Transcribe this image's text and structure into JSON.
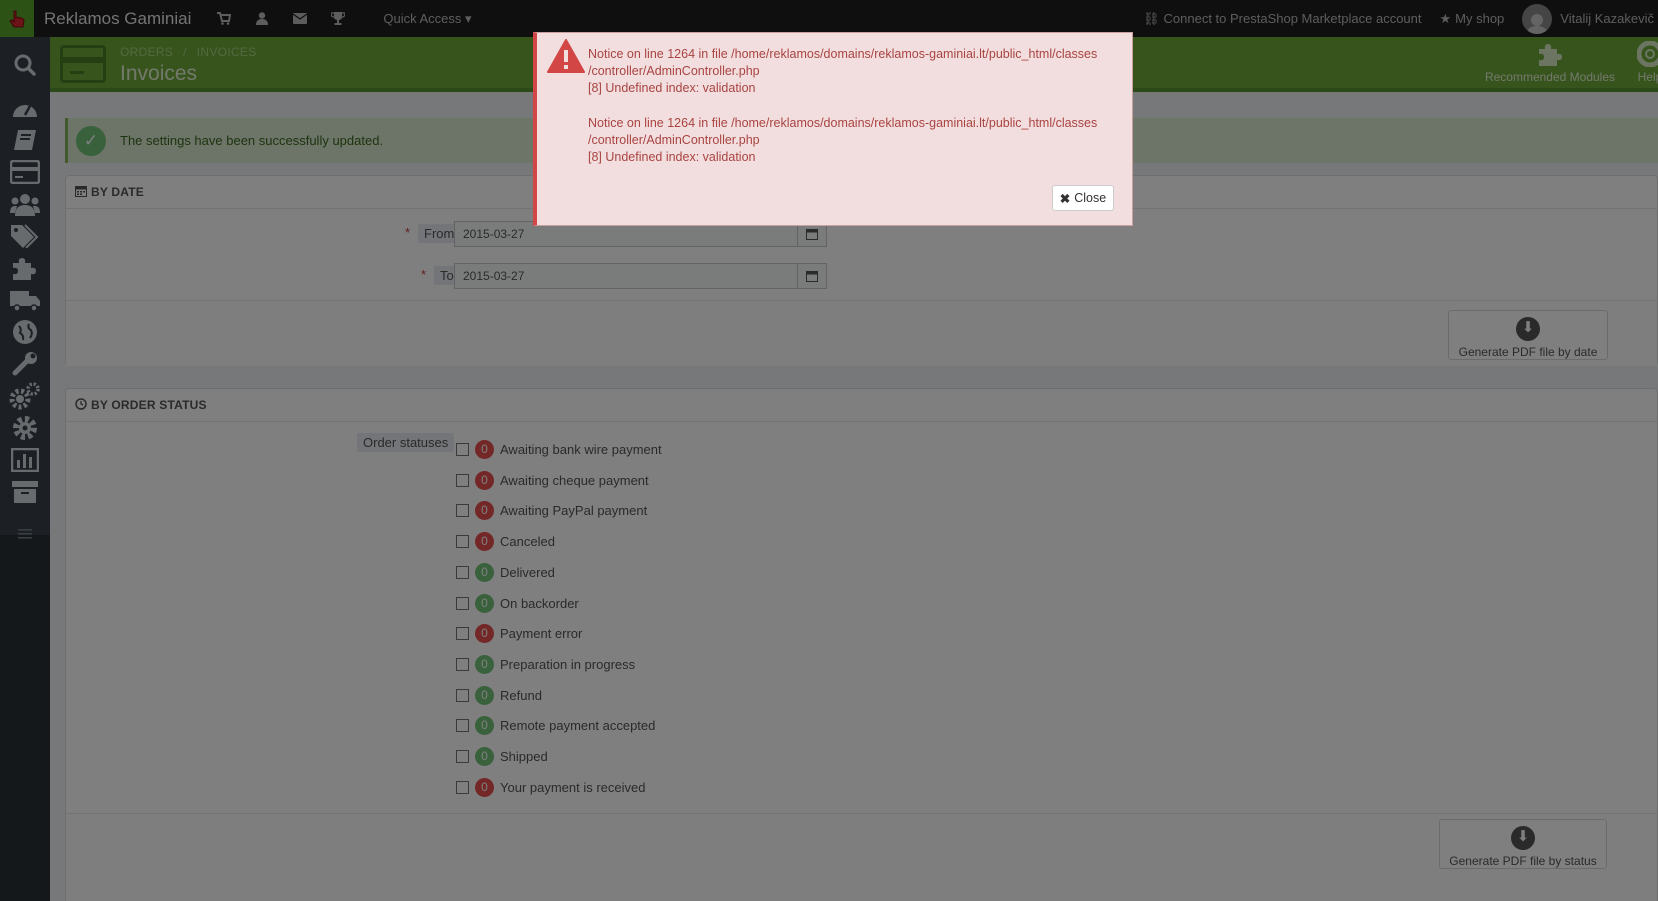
{
  "topbar": {
    "shop_name": "Reklamos Gaminiai",
    "quick_access": "Quick Access",
    "connect_label": "Connect to PrestaShop Marketplace account",
    "my_shop": "My shop",
    "user_name": "Vitalij Kazakevič"
  },
  "header": {
    "breadcrumb": [
      "ORDERS",
      "/",
      "INVOICES"
    ],
    "title": "Invoices",
    "recommended_modules": "Recommended Modules",
    "help": "Help"
  },
  "alert": {
    "success": "The settings have been successfully updated."
  },
  "by_date": {
    "heading": "BY DATE",
    "from_label": "From",
    "from_value": "2015-03-27",
    "to_label": "To",
    "to_value": "2015-03-27",
    "generate_label": "Generate PDF file by date"
  },
  "by_status": {
    "heading": "BY ORDER STATUS",
    "label": "Order statuses",
    "generate_label": "Generate PDF file by status",
    "statuses": [
      {
        "count": "0",
        "color": "red",
        "label": "Awaiting bank wire payment"
      },
      {
        "count": "0",
        "color": "red",
        "label": "Awaiting cheque payment"
      },
      {
        "count": "0",
        "color": "red",
        "label": "Awaiting PayPal payment"
      },
      {
        "count": "0",
        "color": "red",
        "label": "Canceled"
      },
      {
        "count": "0",
        "color": "green",
        "label": "Delivered"
      },
      {
        "count": "0",
        "color": "green",
        "label": "On backorder"
      },
      {
        "count": "0",
        "color": "red",
        "label": "Payment error"
      },
      {
        "count": "0",
        "color": "green",
        "label": "Preparation in progress"
      },
      {
        "count": "0",
        "color": "green",
        "label": "Refund"
      },
      {
        "count": "0",
        "color": "green",
        "label": "Remote payment accepted"
      },
      {
        "count": "0",
        "color": "green",
        "label": "Shipped"
      },
      {
        "count": "0",
        "color": "red",
        "label": "Your payment is received"
      }
    ]
  },
  "modal": {
    "notice1_line1": "Notice on line 1264 in file /home/reklamos/domains/reklamos-gaminiai.lt/public_html/classes",
    "notice1_line2": "/controller/AdminController.php",
    "notice1_line3": "[8] Undefined index: validation",
    "notice2_line1": "Notice on line 1264 in file /home/reklamos/domains/reklamos-gaminiai.lt/public_html/classes",
    "notice2_line2": "/controller/AdminController.php",
    "notice2_line3": "[8] Undefined index: validation",
    "close_label": "Close"
  },
  "colors": {
    "accent": "#6fa83b",
    "error": "#a94442",
    "badge_red": "#e84e4e",
    "badge_green": "#72c279"
  },
  "icons": {
    "topbar": [
      "cart-icon",
      "user-icon",
      "envelope-icon",
      "trophy-icon"
    ],
    "sidebar": [
      "search-icon",
      "dashboard-icon",
      "catalog-icon",
      "orders-icon",
      "customers-icon",
      "price-rules-icon",
      "modules-icon",
      "shipping-icon",
      "localization-icon",
      "preferences-icon",
      "advanced-params-icon",
      "administration-icon",
      "stats-icon",
      "stock-icon",
      "menu-toggle-icon"
    ]
  }
}
